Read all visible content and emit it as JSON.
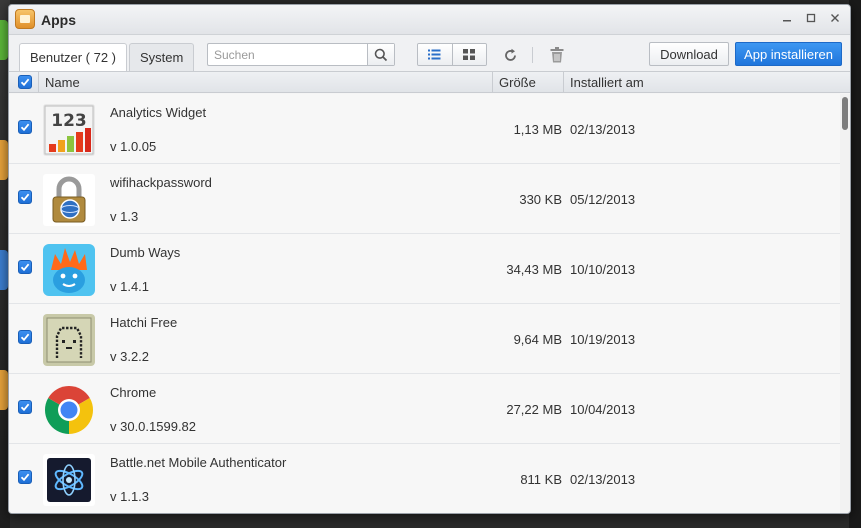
{
  "window": {
    "title": "Apps"
  },
  "toolbar": {
    "tab_user": "Benutzer ( 72 )",
    "tab_system": "System",
    "search_placeholder": "Suchen",
    "download_label": "Download",
    "install_label": "App installieren"
  },
  "table": {
    "columns": {
      "name": "Name",
      "size": "Größe",
      "installed": "Installiert am"
    },
    "rows": [
      {
        "name": "Analytics Widget",
        "version": "v 1.0.05",
        "size": "1,13 MB",
        "date": "02/13/2013",
        "icon": "analytics-widget-icon"
      },
      {
        "name": "wifihackpassword",
        "version": "v 1.3",
        "size": "330 KB",
        "date": "05/12/2013",
        "icon": "padlock-icon"
      },
      {
        "name": "Dumb Ways",
        "version": "v 1.4.1",
        "size": "34,43 MB",
        "date": "10/10/2013",
        "icon": "dumb-ways-icon"
      },
      {
        "name": "Hatchi Free",
        "version": "v 3.2.2",
        "size": "9,64 MB",
        "date": "10/19/2013",
        "icon": "hatchi-icon"
      },
      {
        "name": "Chrome",
        "version": "v 30.0.1599.82",
        "size": "27,22 MB",
        "date": "10/04/2013",
        "icon": "chrome-icon"
      },
      {
        "name": "Battle.net Mobile Authenticator",
        "version": "v 1.1.3",
        "size": "811 KB",
        "date": "02/13/2013",
        "icon": "battle-net-icon"
      }
    ]
  },
  "colors": {
    "accent": "#1f75dc",
    "checkbox": "#2a7fe6"
  }
}
